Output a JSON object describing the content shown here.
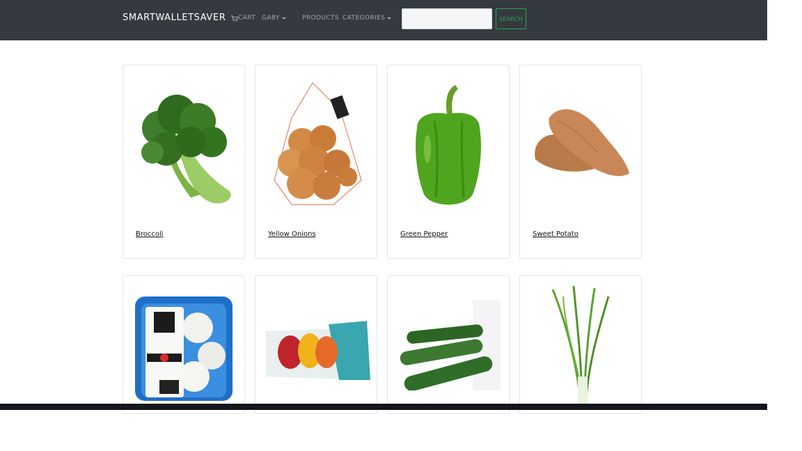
{
  "navbar": {
    "brand": "SMARTWALLETSAVER",
    "cart_label": "CART",
    "user_label": "GABY",
    "products_label": "PRODUCTS",
    "categories_label": "CATEGORIES",
    "search_placeholder": "",
    "search_button": "SEARCH"
  },
  "products": [
    {
      "name": "Broccoli",
      "icon": "broccoli-image"
    },
    {
      "name": "Yellow Onions",
      "icon": "onions-image"
    },
    {
      "name": "Green Pepper",
      "icon": "green-pepper-image"
    },
    {
      "name": "Sweet Potato",
      "icon": "sweet-potato-image"
    },
    {
      "name": "",
      "icon": "white-mushrooms-image"
    },
    {
      "name": "",
      "icon": "mini-peppers-image"
    },
    {
      "name": "",
      "icon": "cucumbers-image"
    },
    {
      "name": "",
      "icon": "green-onions-image"
    }
  ],
  "colors": {
    "navbar_bg": "#343a40",
    "accent_green": "#28a745",
    "footer_bg": "#15161c"
  }
}
